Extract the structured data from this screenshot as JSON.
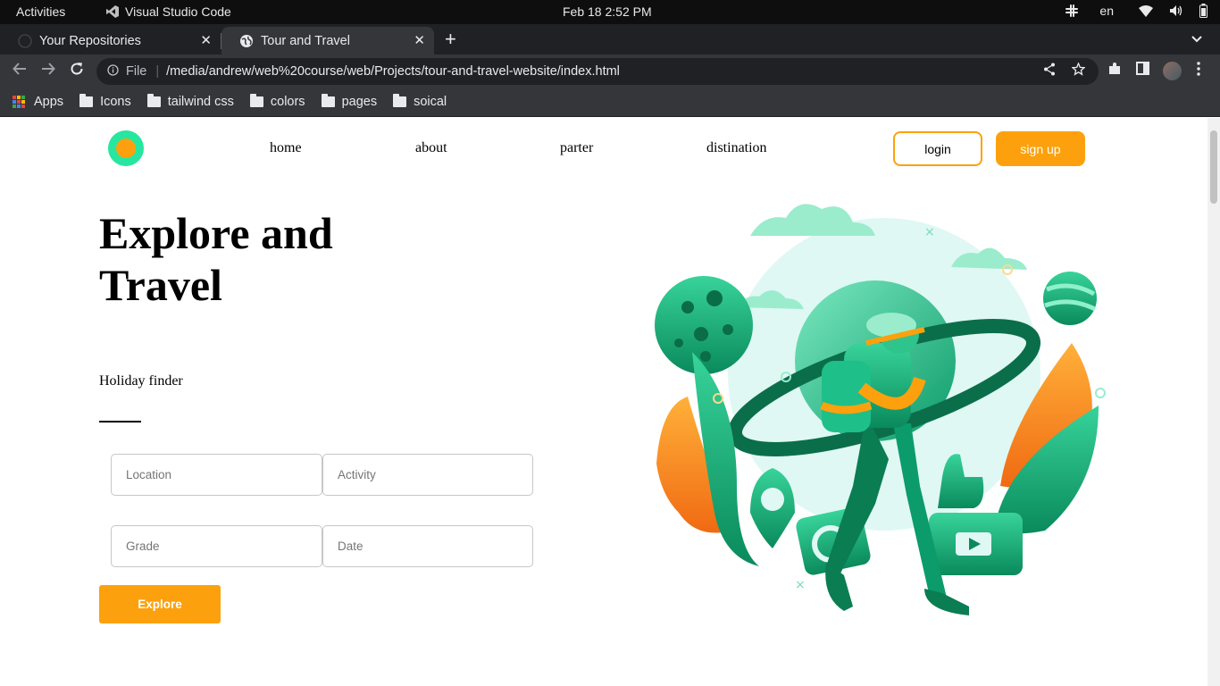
{
  "system": {
    "activities": "Activities",
    "app_name": "Visual Studio Code",
    "clock": "Feb 18   2:52 PM",
    "language": "en"
  },
  "browser": {
    "tabs": [
      {
        "title": "Your Repositories",
        "active": false
      },
      {
        "title": "Tour and Travel",
        "active": true
      }
    ],
    "address": {
      "scheme_label": "File",
      "url": "/media/andrew/web%20course/web/Projects/tour-and-travel-website/index.html"
    },
    "bookmarks": [
      {
        "label": "Apps",
        "icon": "apps-grid-icon"
      },
      {
        "label": "Icons",
        "icon": "folder-icon"
      },
      {
        "label": "tailwind css",
        "icon": "folder-icon"
      },
      {
        "label": "colors",
        "icon": "folder-icon"
      },
      {
        "label": "pages",
        "icon": "folder-icon"
      },
      {
        "label": "soical",
        "icon": "folder-icon"
      }
    ]
  },
  "site": {
    "colors": {
      "accent": "#fca10d",
      "logo_outer": "#27e6a0",
      "green": "#1fbf8a"
    },
    "nav": {
      "home": "home",
      "about": "about",
      "partner": "parter",
      "destination": "distination"
    },
    "auth": {
      "login": "login",
      "signup": "sign up"
    },
    "hero": {
      "title_line1": "Explore and",
      "title_line2": "Travel",
      "subtitle": "Holiday finder"
    },
    "form": {
      "location_placeholder": "Location",
      "activity_placeholder": "Activity",
      "grade_placeholder": "Grade",
      "date_placeholder": "Date",
      "submit_label": "Explore"
    },
    "illustration": "traveler-with-backpack-illustration"
  }
}
